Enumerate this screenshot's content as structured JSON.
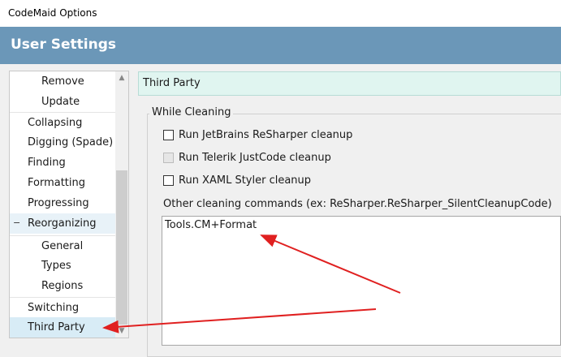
{
  "window": {
    "title": "CodeMaid Options"
  },
  "header": {
    "title": "User Settings"
  },
  "tree": {
    "items": [
      {
        "label": "Remove",
        "level": 2
      },
      {
        "label": "Update",
        "level": 2
      },
      {
        "label": "Collapsing",
        "level": 1
      },
      {
        "label": "Digging (Spade)",
        "level": 1
      },
      {
        "label": "Finding",
        "level": 1
      },
      {
        "label": "Formatting",
        "level": 1
      },
      {
        "label": "Progressing",
        "level": 1
      },
      {
        "label": "Reorganizing",
        "level": 1,
        "expander": "−"
      },
      {
        "label": "General",
        "level": 2
      },
      {
        "label": "Types",
        "level": 2
      },
      {
        "label": "Regions",
        "level": 2
      },
      {
        "label": "Switching",
        "level": 1
      },
      {
        "label": "Third Party",
        "level": 1,
        "selected": true
      }
    ]
  },
  "panel": {
    "title": "Third Party",
    "group_label": "While Cleaning",
    "options": [
      {
        "label": "Run JetBrains ReSharper cleanup",
        "checked": false,
        "enabled": true
      },
      {
        "label": "Run Telerik JustCode cleanup",
        "checked": false,
        "enabled": false
      },
      {
        "label": "Run XAML Styler cleanup",
        "checked": false,
        "enabled": true
      }
    ],
    "commands_label": "Other cleaning commands (ex: ReSharper.ReSharper_SilentCleanupCode)",
    "commands_value": "Tools.CM+Format"
  },
  "colors": {
    "header_bg": "#6b97b8",
    "panel_head_bg": "#e0f5f0",
    "selection_bg": "#d8ecf6",
    "annotation": "#e02020"
  }
}
